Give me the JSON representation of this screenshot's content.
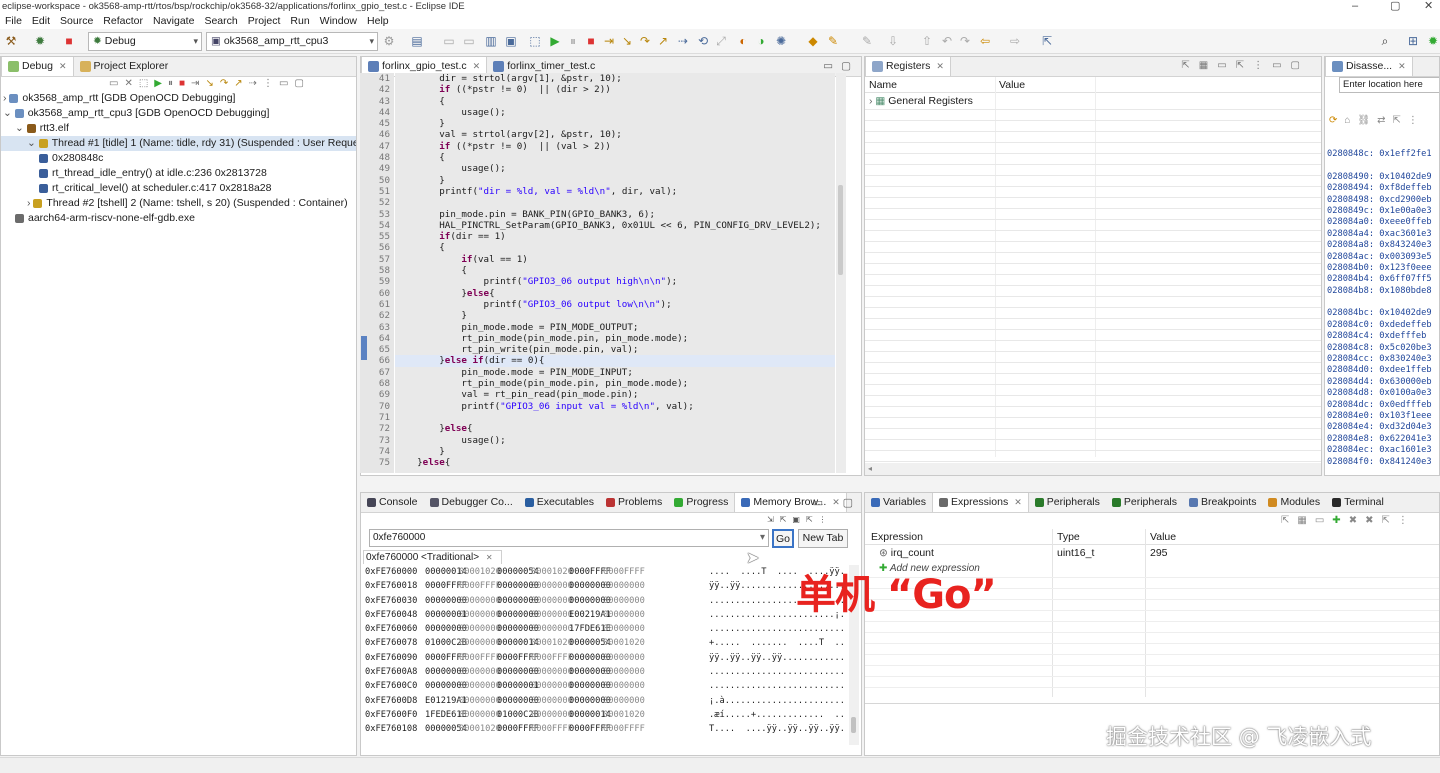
{
  "window": {
    "title": "eclipse-workspace - ok3568-amp-rtt/rtos/bsp/rockchip/ok3568-32/applications/forlinx_gpio_test.c - Eclipse IDE"
  },
  "menu": [
    "File",
    "Edit",
    "Source",
    "Refactor",
    "Navigate",
    "Search",
    "Project",
    "Run",
    "Window",
    "Help"
  ],
  "toolbar": {
    "perspective_combo": "Debug",
    "launch_config_combo": "ok3568_amp_rtt_cpu3"
  },
  "debug_view": {
    "tabs": [
      {
        "label": "Debug"
      },
      {
        "label": "Project Explorer"
      }
    ],
    "items": [
      {
        "label": "ok3568_amp_rtt [GDB OpenOCD Debugging]",
        "level": 0,
        "toggle": ">"
      },
      {
        "label": "ok3568_amp_rtt_cpu3 [GDB OpenOCD Debugging]",
        "level": 0,
        "toggle": "v"
      },
      {
        "label": "rtt3.elf",
        "level": 1,
        "toggle": "v"
      },
      {
        "label": "Thread #1 [tidle] 1 (Name: tidle, rdy 31) (Suspended : User Request)",
        "level": 2,
        "toggle": "v"
      },
      {
        "label": "0x280848c",
        "level": 3,
        "toggle": ""
      },
      {
        "label": "rt_thread_idle_entry() at idle.c:236 0x2813728",
        "level": 3,
        "toggle": ""
      },
      {
        "label": "rt_critical_level() at scheduler.c:417 0x2818a28",
        "level": 3,
        "toggle": ""
      },
      {
        "label": "Thread #2 [tshell] 2 (Name: tshell, s 20) (Suspended : Container)",
        "level": 2,
        "toggle": ">"
      },
      {
        "label": "aarch64-arm-riscv-none-elf-gdb.exe",
        "level": 1,
        "toggle": ""
      }
    ]
  },
  "editor": {
    "tabs": [
      {
        "label": "forlinx_gpio_test.c"
      },
      {
        "label": "forlinx_timer_test.c"
      }
    ],
    "lines": [
      {
        "n": "41",
        "code": "        dir = strtol(argv[1], &pstr, 10);"
      },
      {
        "n": "42",
        "code": "        if ((*pstr != 0)  || (dir > 2))"
      },
      {
        "n": "43",
        "code": "        {"
      },
      {
        "n": "44",
        "code": "            usage();"
      },
      {
        "n": "45",
        "code": "        }"
      },
      {
        "n": "46",
        "code": "        val = strtol(argv[2], &pstr, 10);"
      },
      {
        "n": "47",
        "code": "        if ((*pstr != 0)  || (val > 2))"
      },
      {
        "n": "48",
        "code": "        {"
      },
      {
        "n": "49",
        "code": "            usage();"
      },
      {
        "n": "50",
        "code": "        }"
      },
      {
        "n": "51",
        "code": "        printf(\"dir = %ld, val = %ld\\n\", dir, val);"
      },
      {
        "n": "52",
        "code": ""
      },
      {
        "n": "53",
        "code": "        pin_mode.pin = BANK_PIN(GPIO_BANK3, 6);"
      },
      {
        "n": "54",
        "code": "        HAL_PINCTRL_SetParam(GPIO_BANK3, 0x01UL << 6, PIN_CONFIG_DRV_LEVEL2);   //"
      },
      {
        "n": "55",
        "code": "        if(dir == 1)"
      },
      {
        "n": "56",
        "code": "        {"
      },
      {
        "n": "57",
        "code": "            if(val == 1)"
      },
      {
        "n": "58",
        "code": "            {"
      },
      {
        "n": "59",
        "code": "                printf(\"GPIO3_06 output high\\n\\n\");"
      },
      {
        "n": "60",
        "code": "            }else{"
      },
      {
        "n": "61",
        "code": "                printf(\"GPIO3_06 output low\\n\\n\");"
      },
      {
        "n": "62",
        "code": "            }"
      },
      {
        "n": "63",
        "code": "            pin_mode.mode = PIN_MODE_OUTPUT;"
      },
      {
        "n": "64",
        "code": "            rt_pin_mode(pin_mode.pin, pin_mode.mode);"
      },
      {
        "n": "65",
        "code": "            rt_pin_write(pin_mode.pin, val);"
      },
      {
        "n": "66",
        "code": "        }else if(dir == 0){"
      },
      {
        "n": "67",
        "code": "            pin_mode.mode = PIN_MODE_INPUT;"
      },
      {
        "n": "68",
        "code": "            rt_pin_mode(pin_mode.pin, pin_mode.mode);"
      },
      {
        "n": "69",
        "code": "            val = rt_pin_read(pin_mode.pin);"
      },
      {
        "n": "70",
        "code": "            printf(\"GPIO3_06 input val = %ld\\n\", val);"
      },
      {
        "n": "71",
        "code": ""
      },
      {
        "n": "72",
        "code": "        }else{"
      },
      {
        "n": "73",
        "code": "            usage();"
      },
      {
        "n": "74",
        "code": "        }"
      },
      {
        "n": "75",
        "code": "    }else{"
      }
    ]
  },
  "registers": {
    "tab": "Registers",
    "columns": [
      "Name",
      "Value"
    ],
    "rows": [
      {
        "name": "General Registers",
        "value": ""
      }
    ]
  },
  "disassembly": {
    "tab": "Disasse...",
    "location_placeholder": "Enter location here",
    "lines": [
      "0280848c: 0x1eff2fe1",
      "",
      "02808490: 0x10402de9",
      "02808494: 0xf8deffeb",
      "02808498: 0xcd2900eb",
      "0280849c: 0x1e00a0e3",
      "028084a0: 0xeee0ffeb",
      "028084a4: 0xac3601e3",
      "028084a8: 0x843240e3",
      "028084ac: 0x003093e5",
      "028084b0: 0x123f0eee",
      "028084b4: 0x6ff07ff5",
      "028084b8: 0x1080bde8",
      "",
      "028084bc: 0x10402de9",
      "028084c0: 0xdedeffeb",
      "028084c4: 0xdefffeb",
      "028084c8: 0x5c020be3",
      "028084cc: 0x830240e3",
      "028084d0: 0xdee1ffeb",
      "028084d4: 0x630000eb",
      "028084d8: 0x0100a0e3",
      "028084dc: 0x0edfffeb",
      "028084e0: 0x103f1eee",
      "028084e4: 0xd32d04e3",
      "028084e8: 0x622041e3",
      "028084ec: 0xac1601e3",
      "028084f0: 0x841240e3"
    ]
  },
  "bottom_left": {
    "tabs": [
      {
        "label": "Console"
      },
      {
        "label": "Debugger Co..."
      },
      {
        "label": "Executables"
      },
      {
        "label": "Problems"
      },
      {
        "label": "Progress"
      },
      {
        "label": "Memory Brow..."
      }
    ],
    "address_value": "0xfe760000",
    "go_label": "Go",
    "new_tab_label": "New Tab",
    "memory_tab": "0xfe760000 <Traditional>",
    "rows": [
      {
        "addr": "0xFE760000",
        "c1": "00000014",
        "c2": "00001020",
        "c3": "00000054",
        "c4": "00001020",
        "c5": "0000FFFF",
        "c6": "0000FFFF",
        "ascii": "....  ....T  ....  ....ÿÿ.. ÿÿ.."
      },
      {
        "addr": "0xFE760018",
        "c1": "0000FFFF",
        "c2": "0000FFFF",
        "c3": "00000000",
        "c4": "00000000",
        "c5": "00000000",
        "c6": "00000000",
        "ascii": "ÿÿ..ÿÿ........................"
      },
      {
        "addr": "0xFE760030",
        "c1": "00000000",
        "c2": "00000000",
        "c3": "00000000",
        "c4": "00000000",
        "c5": "00000000",
        "c6": "00000000",
        "ascii": "................................"
      },
      {
        "addr": "0xFE760048",
        "c1": "00000001",
        "c2": "00000000",
        "c3": "00000000",
        "c4": "00000000",
        "c5": "E00219A1",
        "c6": "00000000",
        "ascii": "........................¡.à....."
      },
      {
        "addr": "0xFE760060",
        "c1": "00000000",
        "c2": "00000000",
        "c3": "00000000",
        "c4": "00000000",
        "c5": "17FDE61E",
        "c6": "00000000",
        "ascii": "............................æý.."
      },
      {
        "addr": "0xFE760078",
        "c1": "01000C2B",
        "c2": "00000000",
        "c3": "00000014",
        "c4": "00001020",
        "c5": "00000054",
        "c6": "00001020",
        "ascii": "+.....  .......  ....T  ...."
      },
      {
        "addr": "0xFE760090",
        "c1": "0000FFFF",
        "c2": "0000FFFF",
        "c3": "0000FFFF",
        "c4": "0000FFFF",
        "c5": "00000000",
        "c6": "00000000",
        "ascii": "ÿÿ..ÿÿ..ÿÿ..ÿÿ.................."
      },
      {
        "addr": "0xFE7600A8",
        "c1": "00000000",
        "c2": "00000000",
        "c3": "00000000",
        "c4": "00000000",
        "c5": "00000000",
        "c6": "00000000",
        "ascii": "................................"
      },
      {
        "addr": "0xFE7600C0",
        "c1": "00000000",
        "c2": "00000000",
        "c3": "00000001",
        "c4": "00000000",
        "c5": "00000000",
        "c6": "00000000",
        "ascii": "................................"
      },
      {
        "addr": "0xFE7600D8",
        "c1": "E01219A1",
        "c2": "00000000",
        "c3": "00000000",
        "c4": "00000000",
        "c5": "00000000",
        "c6": "00000000",
        "ascii": "¡.à............................."
      },
      {
        "addr": "0xFE7600F0",
        "c1": "1FEDE61E",
        "c2": "00000000",
        "c3": "01000C2B",
        "c4": "00000000",
        "c5": "00000014",
        "c6": "00001020",
        "ascii": ".æí.....+.............  ...."
      },
      {
        "addr": "0xFE760108",
        "c1": "00000054",
        "c2": "00001020",
        "c3": "0000FFFF",
        "c4": "0000FFFF",
        "c5": "0000FFFF",
        "c6": "0000FFFF",
        "ascii": "T....  ....ÿÿ..ÿÿ..ÿÿ..ÿÿ.."
      }
    ]
  },
  "bottom_right": {
    "tabs": [
      {
        "label": "Variables"
      },
      {
        "label": "Expressions"
      },
      {
        "label": "Peripherals"
      },
      {
        "label": "Peripherals"
      },
      {
        "label": "Breakpoints"
      },
      {
        "label": "Modules"
      },
      {
        "label": "Terminal"
      }
    ],
    "columns": [
      "Expression",
      "Type",
      "Value"
    ],
    "rows": [
      {
        "expression": "irq_count",
        "type": "uint16_t",
        "value": "295"
      }
    ],
    "add_label": "Add new expression"
  },
  "overlay_text": "单机 “Go”",
  "watermark": "掘金技术社区 @ 飞凌嵌入式",
  "colors": {
    "overlay": "#e8231f",
    "keyword": "#7f0055",
    "string": "#2a00ff"
  }
}
